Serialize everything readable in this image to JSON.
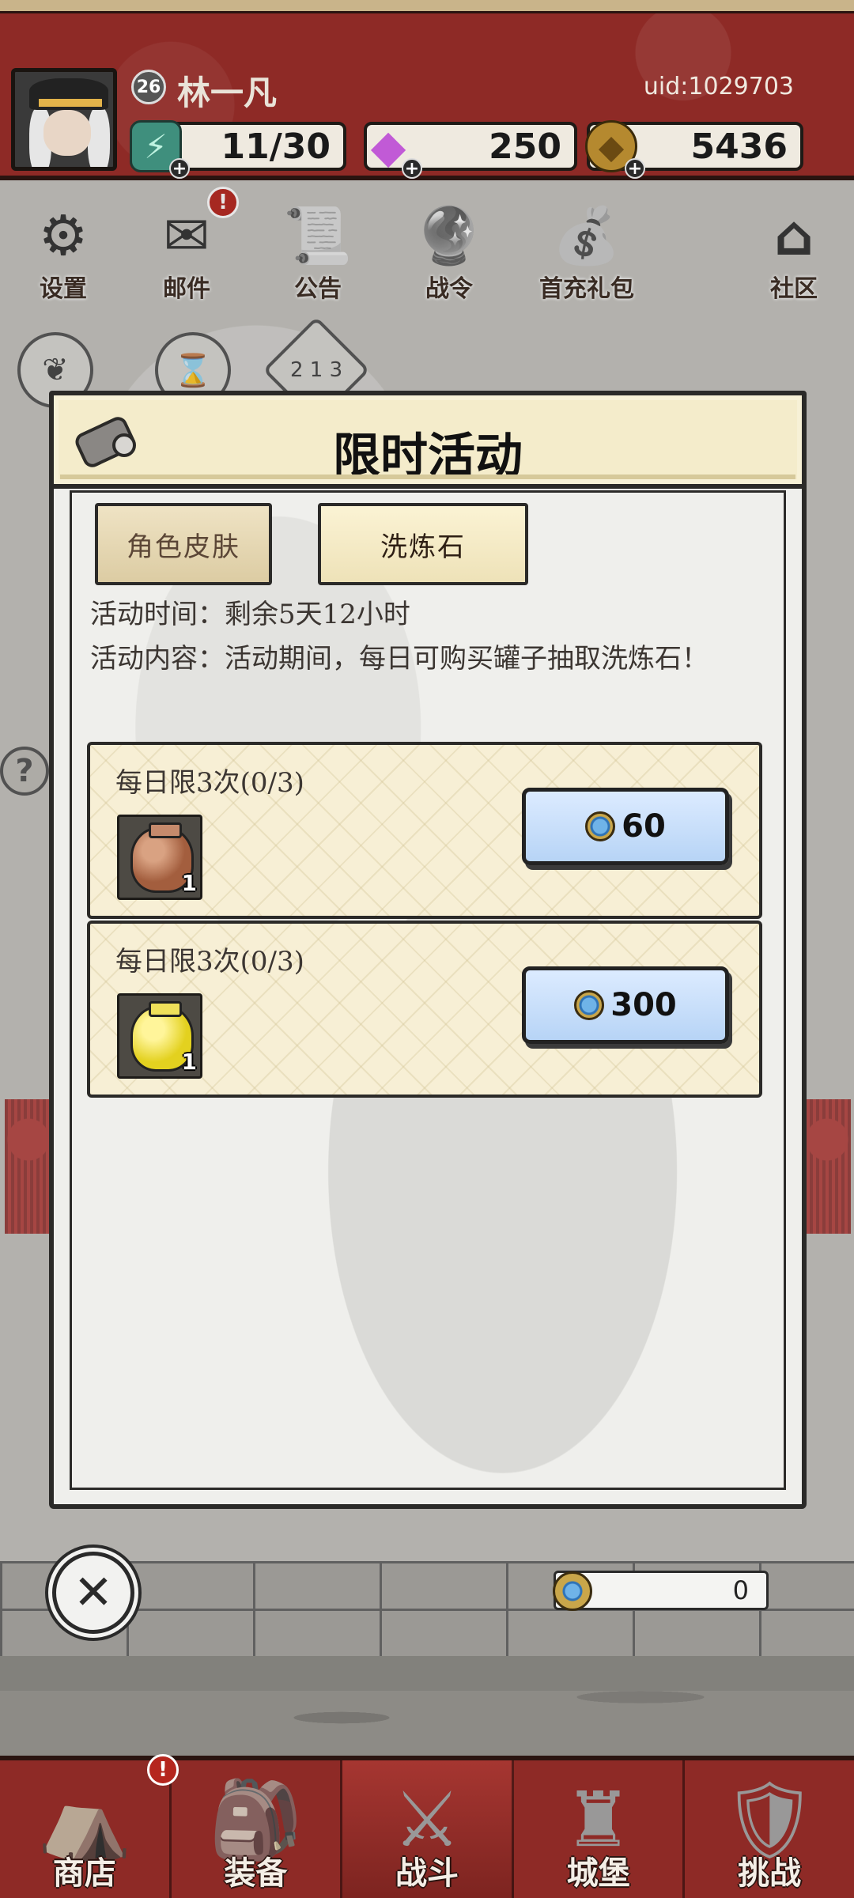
{
  "header": {
    "player_name": "林一凡",
    "level": "26",
    "uid": "uid:1029703",
    "resources": {
      "energy": "11/30",
      "gems": "250",
      "gold": "5436"
    }
  },
  "menu": {
    "items": [
      {
        "label": "设置",
        "icon": "gear-icon"
      },
      {
        "label": "邮件",
        "icon": "mail-icon",
        "alert": "!"
      },
      {
        "label": "公告",
        "icon": "scroll-icon"
      },
      {
        "label": "战令",
        "icon": "crystal-ball-icon"
      },
      {
        "label": "首充礼包",
        "icon": "gift-bag-icon"
      },
      {
        "label": "社区",
        "icon": "home-icon"
      }
    ]
  },
  "modal": {
    "title": "限时活动",
    "tabs": [
      {
        "label": "角色皮肤"
      },
      {
        "label": "洗炼石"
      }
    ],
    "time_text": "活动时间：剩余5天12小时",
    "content_text": "活动内容：活动期间，每日可购买罐子抽取洗炼石！",
    "offers": [
      {
        "limit": "每日限3次(0/3)",
        "item": "brown-jar",
        "qty": "1",
        "price": "60"
      },
      {
        "limit": "每日限3次(0/3)",
        "item": "yellow-jar",
        "qty": "1",
        "price": "300"
      }
    ]
  },
  "balance": {
    "value": "0"
  },
  "bottom_nav": {
    "items": [
      {
        "label": "商店",
        "alert": "!"
      },
      {
        "label": "装备"
      },
      {
        "label": "战斗"
      },
      {
        "label": "城堡"
      },
      {
        "label": "挑战"
      }
    ]
  },
  "colors": {
    "header_red": "#8e2a26",
    "buy_button_blue": "#b7d4f6",
    "panel_cream": "#f7efd5"
  }
}
